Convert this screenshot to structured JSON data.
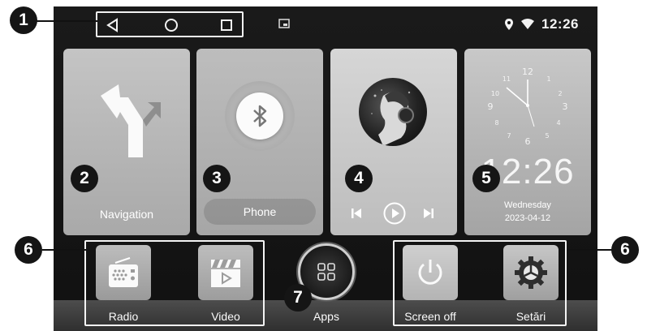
{
  "status_bar": {
    "nav_keys": [
      "back-triangle-icon",
      "home-circle-icon",
      "recents-square-icon"
    ],
    "clock": "12:26",
    "icons": [
      "location-pin-icon",
      "wifi-icon"
    ]
  },
  "tiles": {
    "navigation": {
      "label": "Navigation",
      "icon": "turn-arrow-icon"
    },
    "phone": {
      "label": "Phone",
      "icon": "bluetooth-icon"
    },
    "music": {
      "controls": [
        "previous-icon",
        "play-icon",
        "next-icon"
      ]
    },
    "clock": {
      "time": "12:26",
      "weekday": "Wednesday",
      "date": "2023-04-12"
    }
  },
  "dock": {
    "apps": [
      {
        "label": "Radio",
        "icon": "radio-icon"
      },
      {
        "label": "Video",
        "icon": "clapperboard-icon"
      },
      {
        "label": "Apps",
        "icon": "app-grid-icon"
      },
      {
        "label": "Screen off",
        "icon": "power-icon"
      },
      {
        "label": "Setări",
        "icon": "gear-icon"
      }
    ]
  },
  "callouts": [
    "1",
    "2",
    "3",
    "4",
    "5",
    "6",
    "6",
    "7"
  ],
  "colors": {
    "background": "#111111",
    "tile": "#b3b3b3",
    "text": "#ffffff",
    "callout": "#151515"
  }
}
